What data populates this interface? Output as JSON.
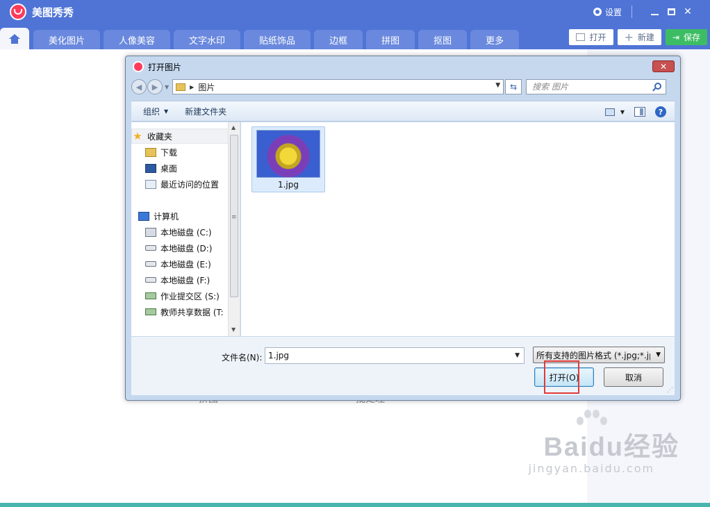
{
  "app": {
    "title": "美图秀秀",
    "settings_label": "设置",
    "tabs": [
      "美化图片",
      "人像美容",
      "文字水印",
      "贴纸饰品",
      "边框",
      "拼图",
      "抠图",
      "更多"
    ],
    "actions": {
      "open": "打开",
      "new": "新建",
      "save": "保存"
    },
    "bg_labels": [
      "拼图",
      "批处理"
    ],
    "colors": {
      "header": "#4f74d6",
      "accent_save": "#3cbd63",
      "highlight": "#e03a3a"
    }
  },
  "dialog": {
    "title": "打开图片",
    "close_label": "✕",
    "breadcrumb": "图片",
    "search_placeholder": "搜索 图片",
    "toolbar": {
      "organize": "组织",
      "new_folder": "新建文件夹"
    },
    "nav": {
      "favorites": "收藏夹",
      "favorites_items": [
        "下载",
        "桌面",
        "最近访问的位置"
      ],
      "computer": "计算机",
      "computer_items": [
        "本地磁盘 (C:)",
        "本地磁盘 (D:)",
        "本地磁盘 (E:)",
        "本地磁盘 (F:)",
        "作业提交区 (S:)",
        "教师共享数据 (T:"
      ]
    },
    "files": [
      {
        "name": "1.jpg"
      }
    ],
    "filename_label": "文件名(N):",
    "filename_value": "1.jpg",
    "filetype_value": "所有支持的图片格式 (*.jpg;*.jp",
    "open_button": "打开(O)",
    "cancel_button": "取消"
  },
  "watermark": {
    "main": "Baidu经验",
    "sub": "jingyan.baidu.com"
  }
}
